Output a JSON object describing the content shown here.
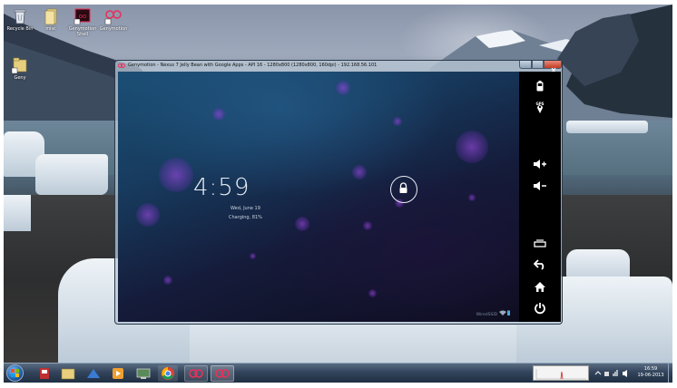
{
  "desktop": {
    "icons": [
      {
        "label": "Recycle Bin"
      },
      {
        "label": "misc"
      },
      {
        "label": "Genymotion Shell"
      },
      {
        "label": "Genymotion"
      },
      {
        "label": "Geny"
      }
    ]
  },
  "window": {
    "title": "Genymotion - Nexus 7 Jelly Bean with Google Apps - API 16 - 1280x800 (1280x800, 160dpi) - 192.168.56.101"
  },
  "lockscreen": {
    "time": "4:59",
    "date": "Wed, June 19",
    "charging": "Charging, 81%",
    "network": "WiredSSID"
  },
  "sidebar": {
    "buttons": [
      {
        "icon": "battery-icon"
      },
      {
        "icon": "gps-icon",
        "label": "GPS"
      },
      {
        "icon": "volume-up-icon"
      },
      {
        "icon": "volume-down-icon"
      },
      {
        "icon": "recent-apps-icon"
      },
      {
        "icon": "back-icon"
      },
      {
        "icon": "home-icon"
      },
      {
        "icon": "power-icon"
      }
    ]
  },
  "taskbar": {
    "items": [
      "start-button",
      "app-icon",
      "explorer",
      "network-app",
      "media-player",
      "remote-desktop",
      "chrome",
      "genymotion-1",
      "genymotion-2"
    ],
    "clock_time": "16:59",
    "clock_date": "19-06-2013"
  },
  "colors": {
    "accent_pink": "#e8305a",
    "sidebar_bg": "#000000",
    "taskbar_bg": "#33455c"
  }
}
